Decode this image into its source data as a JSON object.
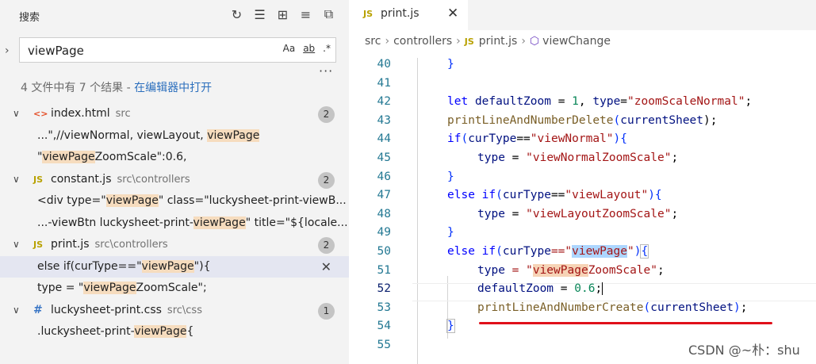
{
  "sidebar": {
    "title": "搜索",
    "actions": [
      "refresh-icon",
      "clear-results-icon",
      "new-search-editor-icon",
      "collapse-all-icon",
      "expand-all-icon"
    ],
    "search": {
      "value": "viewPage",
      "opt_case": "Aa",
      "opt_word": "ab",
      "opt_regex": ".*"
    },
    "summary": {
      "text": "4 文件中有 7 个结果 - ",
      "link": "在编辑器中打开"
    },
    "files": [
      {
        "name": "index.html",
        "path": "src",
        "icon": "<>",
        "count": "2",
        "matches": [
          [
            "...\",//viewNormal, viewLayout, ",
            "viewPage",
            ""
          ],
          [
            "\"",
            "viewPage",
            "ZoomScale\":0.6,"
          ]
        ]
      },
      {
        "name": "constant.js",
        "path": "src\\controllers",
        "icon": "JS",
        "count": "2",
        "matches": [
          [
            "<div type=\"",
            "viewPage",
            "\" class=\"luckysheet-print-viewB..."
          ],
          [
            "...-viewBtn luckysheet-print-",
            "viewPage",
            "\" title=\"${locale..."
          ]
        ]
      },
      {
        "name": "print.js",
        "path": "src\\controllers",
        "icon": "JS",
        "count": "2",
        "matches": [
          [
            "else if(curType==\"",
            "viewPage",
            "\"){"
          ],
          [
            "type = \"",
            "viewPage",
            "ZoomScale\";"
          ]
        ]
      },
      {
        "name": "luckysheet-print.css",
        "path": "src\\css",
        "icon": "#",
        "count": "1",
        "matches": [
          [
            ".luckysheet-print-",
            "viewPage",
            "{"
          ]
        ]
      }
    ]
  },
  "editor": {
    "tab": {
      "icon": "JS",
      "label": "print.js"
    },
    "breadcrumb": {
      "a": "src",
      "b": "controllers",
      "c": "print.js",
      "d": "viewChange"
    },
    "line_numbers": [
      "40",
      "41",
      "42",
      "43",
      "44",
      "45",
      "46",
      "47",
      "48",
      "49",
      "50",
      "51",
      "52",
      "53",
      "54",
      "55"
    ],
    "code": {
      "l40_a": "}",
      "l42_a": "let",
      "l42_b": "defaultZoom",
      "l42_c": " = ",
      "l42_d": "1",
      "l42_e": ", ",
      "l42_f": "type",
      "l42_g": "=",
      "l42_h": "\"zoomScaleNormal\"",
      "l42_i": ";",
      "l43_a": "printLineAndNumberDelete",
      "l43_b": "(",
      "l43_c": "currentSheet",
      "l43_d": ");",
      "l44_a": "if",
      "l44_b": "(",
      "l44_c": "curType",
      "l44_d": "==",
      "l44_e": "\"viewNormal\"",
      "l44_f": "){",
      "l45_a": "type",
      "l45_b": " = ",
      "l45_c": "\"viewNormalZoomScale\"",
      "l45_d": ";",
      "l46_a": "}",
      "l47_a": "else if",
      "l47_b": "(",
      "l47_c": "curType",
      "l47_d": "==",
      "l47_e": "\"viewLayout\"",
      "l47_f": "){",
      "l48_a": "type",
      "l48_b": " = ",
      "l48_c": "\"viewLayoutZoomScale\"",
      "l48_d": ";",
      "l49_a": "}",
      "l50_a": "else if",
      "l50_b": "(",
      "l50_c": "curType",
      "l50_d": "==\"",
      "l50_e": "viewPage",
      "l50_f": "\"",
      "l50_g": ")",
      "l50_h": "{",
      "l51_a": "type",
      "l51_b": " = \"",
      "l51_c": "viewPage",
      "l51_d": "ZoomScale\"",
      "l51_e": ";",
      "l52_a": "defaultZoom",
      "l52_b": " = ",
      "l52_c": "0.6",
      "l52_d": ";",
      "l53_a": "printLineAndNumberCreate",
      "l53_b": "(",
      "l53_c": "currentSheet",
      "l53_d": ")",
      "l53_e": ";",
      "l54_a": "}"
    }
  },
  "watermark": "CSDN @~朴：shu",
  "colors": {
    "accent_link": "#2c6fbd",
    "match_highlight": "#f6dcbe",
    "annotation_red": "#e0101a"
  }
}
